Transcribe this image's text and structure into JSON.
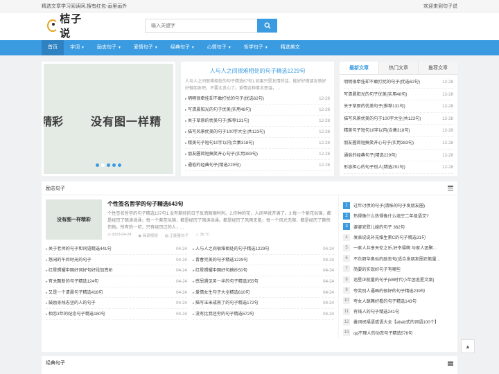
{
  "topbar": {
    "left": "精选文章学习阅读网,搜有红包-画里画外",
    "right": "欢迎来到句子说"
  },
  "logo": {
    "text": "桔子说"
  },
  "search": {
    "placeholder": "输入关键字"
  },
  "nav": {
    "items": [
      {
        "label": "首页",
        "dropdown": false,
        "active": true
      },
      {
        "label": "字词",
        "dropdown": true
      },
      {
        "label": "励志句子",
        "dropdown": true
      },
      {
        "label": "爱情句子",
        "dropdown": true
      },
      {
        "label": "经典句子",
        "dropdown": true
      },
      {
        "label": "心情句子",
        "dropdown": true
      },
      {
        "label": "哲学句子",
        "dropdown": true
      },
      {
        "label": "精选美文",
        "dropdown": false
      }
    ]
  },
  "slider": {
    "text": "没有图一样精",
    "text_partial": "精彩",
    "slide_count": 5,
    "active_index": 1
  },
  "featured": {
    "title": "人与人之间很难相处的句子精选1229句",
    "desc": "人与人之间很难相处的句子精选67句1.如果只是友情的话，能好好做朋友就好好做朋友吧，不要太贪心了。爱情这种事太怒温，...",
    "items": [
      {
        "title": "明明很牵挂却不敢打扰的句子(优选62句)",
        "date": "12-28"
      },
      {
        "title": "写清晨阳光的句子优美(实用48句)",
        "date": "12-28"
      },
      {
        "title": "关于草原的优美句子(推荐131句)",
        "date": "12-28"
      },
      {
        "title": "描写风景优美的句子100字大全(共123句)",
        "date": "12-28"
      },
      {
        "title": "精美句子短句10字以内(合集318句)",
        "date": "12-28"
      },
      {
        "title": "朋友圈简短搞笑开心句子(实用383句)",
        "date": "12-28"
      },
      {
        "title": "通俗的经典句子(精选229句)",
        "date": "12-28"
      }
    ]
  },
  "tabsbox": {
    "tabs": [
      "最新文章",
      "热门文章",
      "推荐文章"
    ],
    "active_tab": 0,
    "items": [
      {
        "title": "明明很牵挂却不敢打扰的句子(优选62句)",
        "date": "12-28"
      },
      {
        "title": "写清晨阳光的句子优美(实用48句)",
        "date": "12-28"
      },
      {
        "title": "关于草原的优美句子(推荐131句)",
        "date": "12-28"
      },
      {
        "title": "描写风景优美的句子100字大全(共123句)",
        "date": "12-28"
      },
      {
        "title": "精美句子短句10字以内(合集318句)",
        "date": "12-28"
      },
      {
        "title": "朋友圈简短搞笑开心句子(实用383句)",
        "date": "12-28"
      },
      {
        "title": "通俗的经典句子(精选229句)",
        "date": "12-28"
      },
      {
        "title": "形容担心的句子别人(精选291句)",
        "date": "12-28"
      }
    ]
  },
  "section1": {
    "title": "励志句子",
    "article": {
      "thumb_text": "没有图一样精彩",
      "title": "个性签名哲学的句子精选643句",
      "desc": "个性签名哲学的句子精选137句1.没有期待的日子反而顺顺利利。2.你种的花，人间早就开满了。3.每一个紫花似锦，都是经历了暗涛汹涌；每一个紫花似锦，都是经历了暗涛汹涌。都是经历了风雨无阻；每一个风光无限，都是经历了颠然伤悔。所有的一切，只有经历过的人，...",
      "date": "2023-04-24",
      "views": "阅读视频",
      "category": "正能量句子",
      "temp": "36 °C"
    },
    "left_items": [
      {
        "title": "关于老师的句子和词语精选441句",
        "date": "04-24"
      },
      {
        "title": "悠闲的午后时光的句子",
        "date": "04-24"
      },
      {
        "title": "红星照耀中国好词好句好段加赏析",
        "date": "04-24"
      },
      {
        "title": "有关飘新的句子精选124句",
        "date": "04-24"
      },
      {
        "title": "又是一个清晨句子精选416句",
        "date": "04-24"
      },
      {
        "title": "鼓励身残志坚的人的句子",
        "date": "04-24"
      },
      {
        "title": "相恋3年的纪念句子精选180句",
        "date": "04-24"
      }
    ],
    "right_items": [
      {
        "title": "人与人之间很难相处的句子精选1229句",
        "date": "04-24"
      },
      {
        "title": "青春完美的句子精选1229句",
        "date": "04-24"
      },
      {
        "title": "红星照耀中国好句摘抄50句",
        "date": "04-24"
      },
      {
        "title": "感恩遇见另一半的句子精选355句",
        "date": "04-24"
      },
      {
        "title": "爱情女生句子大全精选610句",
        "date": "04-24"
      },
      {
        "title": "描写玉米成熟了的句子精选172句",
        "date": "04-24"
      },
      {
        "title": "没有比我还穷的句子精选572句",
        "date": "04-24"
      }
    ],
    "rank": [
      "过年讨债的句子(清帐的句子发朋友圈)",
      "热得像什么热得像什么填空二年级语文?",
      "婆婆安慰儿媳的句子 362句",
      "发表说说补充维生素C的句子精选31句",
      "一家人共享天伦之乐,好幸福啊 与家人团聚...",
      "不负韶华奥似的励志句(适合发朋友圈正能量...",
      "简要的实现好句子有哪些",
      "追星正能量的句子(kB时代小年团追星文案)",
      "夸奖别人逼画的很好的句子精选239句",
      "夸女人跳舞好看的句子精选143句",
      "有钱人的句子精选241句",
      "叠词祝福语或语大全【abab式的词语100个】",
      "qq不理人的动态句子精选578句"
    ]
  },
  "section2": {
    "title": "经典句子"
  },
  "totop": {
    "icon": "arrow-up-icon"
  },
  "colors": {
    "accent": "#3a9be0",
    "nav_active": "#2f82c2"
  }
}
